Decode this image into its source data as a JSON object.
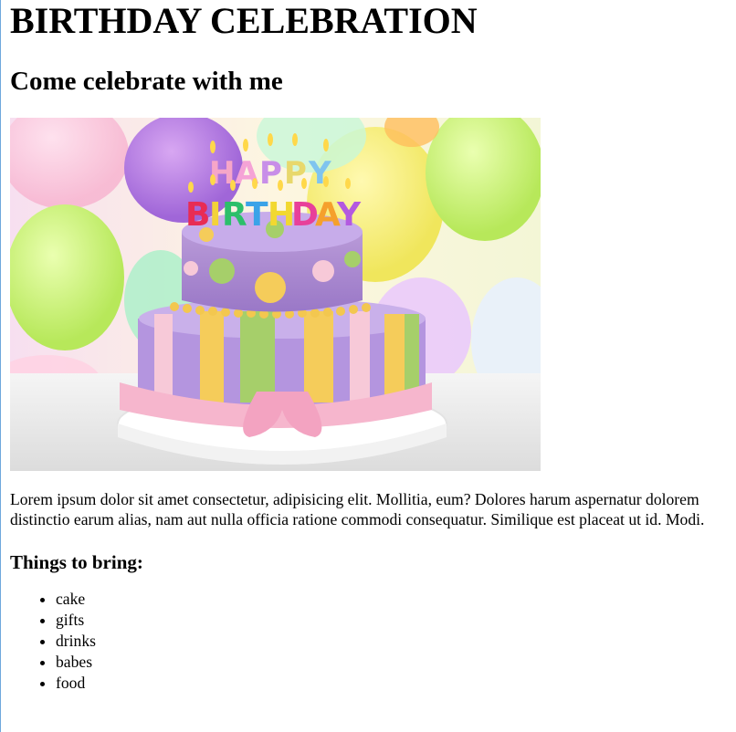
{
  "header": {
    "title": "BIRTHDAY CELEBRATION",
    "subtitle": "Come celebrate with me"
  },
  "hero_image": {
    "description_icon": "birthday-cake-image",
    "candle_letters_top": "HAPPY",
    "candle_letters_bottom": "BIRTHDAY"
  },
  "intro": {
    "text": "Lorem ipsum dolor sit amet consectetur, adipisicing elit. Mollitia, eum? Dolores harum aspernatur dolorem distinctio earum alias, nam aut nulla officia ratione commodi consequatur. Similique est placeat ut id. Modi."
  },
  "bring": {
    "heading": "Things to bring:",
    "items": [
      "cake",
      "gifts",
      "drinks",
      "babes",
      "food"
    ]
  },
  "colors": {
    "page_border": "#6fa8dc",
    "text": "#000000",
    "background": "#ffffff"
  }
}
